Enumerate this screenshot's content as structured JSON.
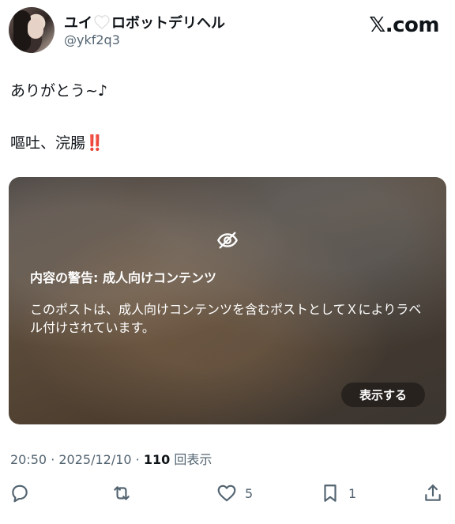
{
  "author": {
    "display_name_before": "ユイ",
    "display_name_after": "ロボットデリヘル",
    "handle": "@ykf2q3"
  },
  "brand": {
    "logo_text": ".com",
    "logo_mark": "𝕏"
  },
  "tweet": {
    "line1": "ありがとう~♪",
    "line2": "嘔吐、浣腸",
    "line2_emoji": "‼️"
  },
  "content_warning": {
    "title": "内容の警告: 成人向けコンテンツ",
    "body": "このポストは、成人向けコンテンツを含むポストとしてＸによりラベル付けされています。",
    "show_label": "表示する"
  },
  "meta": {
    "time": "20:50",
    "sep1": " · ",
    "date": "2025/12/10",
    "sep2": " · ",
    "views_count": "110",
    "views_label": " 回表示"
  },
  "actions": {
    "reply_count": "",
    "repost_count": "",
    "like_count": "5",
    "bookmark_count": "1"
  },
  "colors": {
    "text_primary": "#0f1419",
    "text_secondary": "#536471",
    "emoji_red": "#e0245e"
  }
}
